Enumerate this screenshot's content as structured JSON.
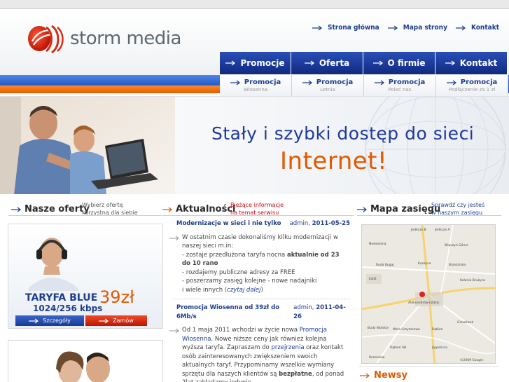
{
  "brand": {
    "name": "storm media"
  },
  "toplinks": [
    "Strona główna",
    "Mapa strony",
    "Kontakt"
  ],
  "nav": [
    "Promocje",
    "Oferta",
    "O firmie",
    "Kontakt"
  ],
  "subnav": [
    {
      "label": "Promocja",
      "sub": "Wiosenna"
    },
    {
      "label": "Promocja",
      "sub": "Letnia"
    },
    {
      "label": "Promocja",
      "sub": "Poleć nas"
    },
    {
      "label": "Promocja",
      "sub": "Podłączenie za 1 zł"
    }
  ],
  "banner": {
    "line1": "Stały i szybki dostęp do sieci",
    "line2": "Internet!"
  },
  "sections": {
    "offers": {
      "title": "Nasze oferty",
      "sub1": "Wybierz ofertę",
      "sub2": "korzystną dla siebie"
    },
    "news": {
      "title": "Aktualności",
      "sub1": "Bieżące informacje",
      "sub2": "na temat serwisu"
    },
    "map": {
      "title": "Mapa zasięgu",
      "sub1": "Sprawdź czy jesteś",
      "sub2": "w naszym zasięgu"
    },
    "newsy": "Newsy"
  },
  "offer_card": {
    "name": "TARYFA BLUE",
    "speed": "1024/256 kbps",
    "price": "39zł",
    "details_btn": "Szczegóły",
    "order_btn": "Zamów"
  },
  "news_items": [
    {
      "title": "Modernizacje w sieci i nie tylko",
      "author": "admin,",
      "date": "2011-05-25",
      "intro": "W ostatnim czasie dokonaliśmy kilku modernizacji w naszej sieci m.in:",
      "b1_pre": "- zostaje przedłużona taryfa nocna ",
      "b1_bold": "aktualnie od 23 do 10 rano",
      "b2": "- rozdajemy publiczne adresy za FREE",
      "b3": "- poszerzamy zasięg kolejne - nowe nadajniki",
      "b4_pre": "i wiele innych (",
      "b4_link": "czytaj dalej",
      "b4_post": ")"
    },
    {
      "title": "Promocja Wiosenna od 39zł do 6Mb/s",
      "author": "admin,",
      "date": "2011-04-26",
      "p1": "Od 1 maja 2011 wchodzi w życie nowa ",
      "p1_link": "Promocja Wiosenna",
      "p2": ". Nowe niższe ceny jak również kolejna wyższa taryfa. Zapraszam do ",
      "p2_link": "przejrzenia",
      "p3": " oraz kontakt osób zainteresowanych zwiększeniem swoich aktualnych taryf. Przypominamy wszelkie wymiany sprzętu dla naszych klientów są ",
      "p3_bold": "bezpłatne",
      "p4": ", od ponad 2lat zakładamy jedynie"
    }
  ],
  "map_labels": [
    "Jedlicze B",
    "Jedlicze A",
    "Nowosolna",
    "Wiączyń Górne",
    "Ruda Bugaj",
    "Kęszyce",
    "Brzezińska",
    "Kolonia Brużyca",
    "Łódź",
    "Aleksandrów Łódzki",
    "Budy Wolskie",
    "Gimzówek",
    "Wola Grzymkowa",
    "Rąbień",
    "Rąbień AB",
    "Jagodnica",
    "Remiszew",
    "©2009 Google"
  ],
  "colors": {
    "primary": "#1e3d8f",
    "accent": "#e05a00",
    "nav": "#1a3898"
  }
}
